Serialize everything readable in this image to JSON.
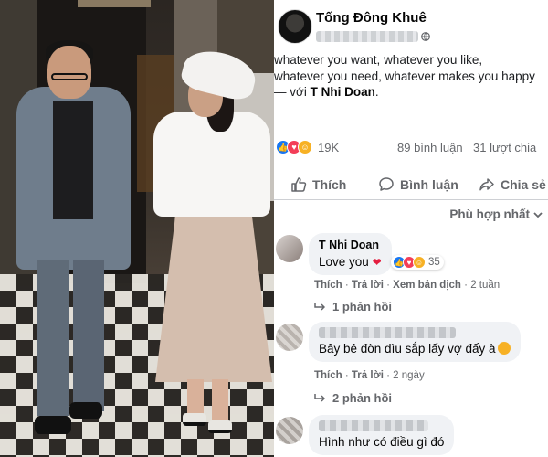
{
  "post": {
    "poster_name": "Tống Đông Khuê",
    "text_lines": [
      "whatever you want, whatever you like,",
      "whatever you need, whatever makes you happy"
    ],
    "tag_prefix": "— với ",
    "tag_name": "T Nhi Doan",
    "tag_suffix": ".",
    "reaction_count": "19K",
    "comments_count": "89 bình luận",
    "shares_count": "31 lượt chia",
    "actions": {
      "like": "Thích",
      "comment": "Bình luận",
      "share": "Chia sẻ"
    },
    "sort_label": "Phù hợp nhất"
  },
  "comments": [
    {
      "name": "T Nhi Doan",
      "text": "Love you",
      "reaction_count": "35",
      "actions": {
        "like": "Thích",
        "reply": "Trả lời",
        "translate": "Xem bản dịch",
        "time": "2 tuần"
      },
      "replies": "1 phản hồi"
    },
    {
      "text": "Bây bê đòn dìu sắp lấy vợ đấy à",
      "actions": {
        "like": "Thích",
        "reply": "Trả lời",
        "time": "2 ngày"
      },
      "replies": "2 phản hồi"
    },
    {
      "text": "Hình như có điều gì đó"
    }
  ],
  "colors": {
    "fb_blue": "#1877f2",
    "love_red": "#f33e58",
    "haha_yellow": "#f7b125",
    "secondary_text": "#65676b",
    "bubble_bg": "#f0f2f5"
  },
  "icons": [
    "globe-icon",
    "like-icon",
    "comment-icon",
    "share-icon",
    "chevron-down-icon",
    "reply-arrow-icon"
  ]
}
